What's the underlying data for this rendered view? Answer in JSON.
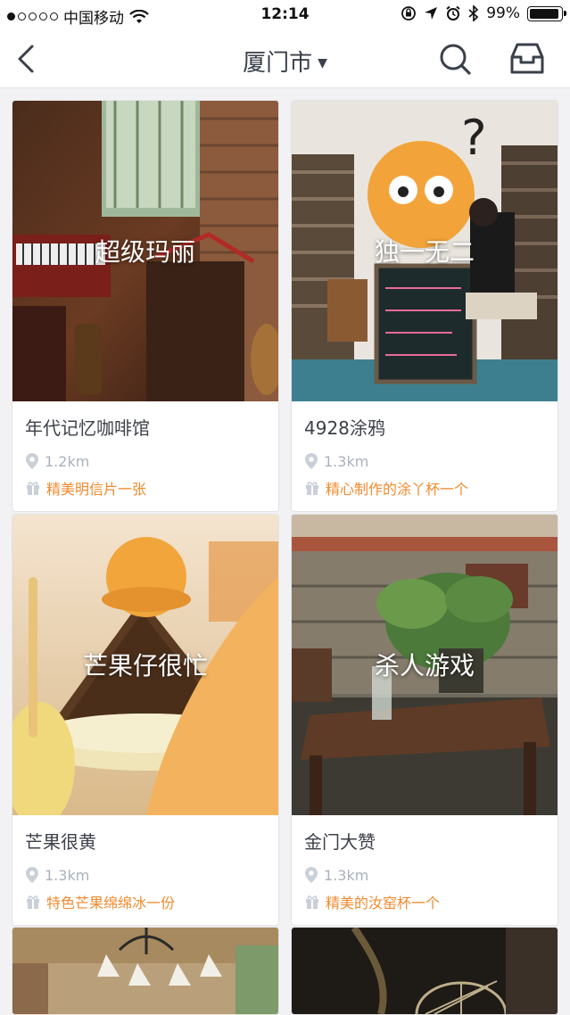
{
  "status_bar": {
    "carrier": "中国移动",
    "time": "12:14",
    "battery": "99%"
  },
  "nav": {
    "title": "厦门市"
  },
  "cards": [
    {
      "overlay": "超级玛丽",
      "name": "年代记忆咖啡馆",
      "distance": "1.2km",
      "gift": "精美明信片一张"
    },
    {
      "overlay": "独一无二",
      "name": "4928涂鸦",
      "distance": "1.3km",
      "gift": "精心制作的涂丫杯一个"
    },
    {
      "overlay": "芒果仔很忙",
      "name": "芒果很黄",
      "distance": "1.3km",
      "gift": "特色芒果绵绵冰一份"
    },
    {
      "overlay": "杀人游戏",
      "name": "金门大赞",
      "distance": "1.3km",
      "gift": "精美的汝窑杯一个"
    }
  ],
  "colors": {
    "accent_orange": "#f08a2e",
    "muted": "#a9b1bc",
    "text": "#3c4049"
  }
}
